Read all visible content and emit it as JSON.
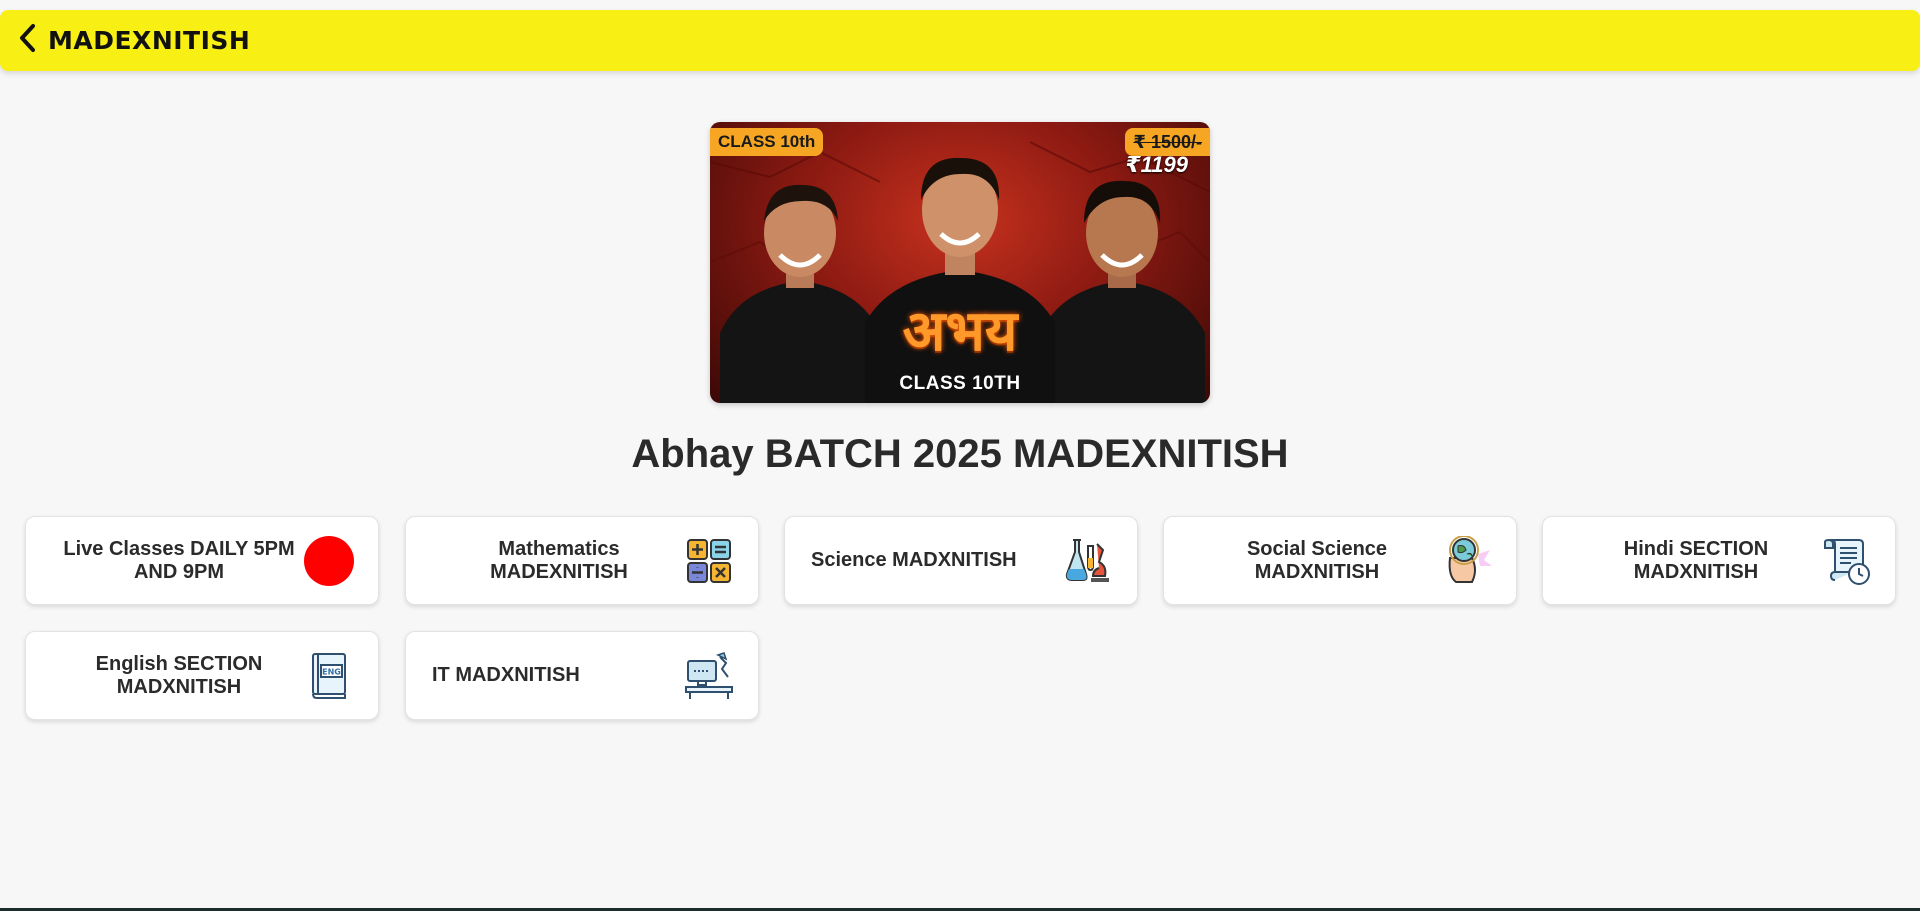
{
  "header": {
    "title": "MADEXNITISH",
    "back_icon": "chevron-left-icon"
  },
  "banner": {
    "class_badge": "CLASS 10th",
    "old_price": "₹ 1500/-",
    "new_price": "₹1199",
    "logo_text": "अभय",
    "class_label": "CLASS 10TH"
  },
  "batch": {
    "title": "Abhay BATCH 2025 MADEXNITISH"
  },
  "sections": [
    {
      "label": "Live Classes DAILY 5PM AND 9PM",
      "icon": "live-dot-icon",
      "color": "#ff0000"
    },
    {
      "label": "Mathematics MADEXNITISH",
      "icon": "calculator-icon"
    },
    {
      "label": "Science MADXNITISH",
      "icon": "lab-flask-microscope-icon"
    },
    {
      "label": "Social Science MADXNITISH",
      "icon": "globe-magnifier-icon"
    },
    {
      "label": "Hindi SECTION MADXNITISH",
      "icon": "scroll-clock-icon"
    },
    {
      "label": "English SECTION MADXNITISH",
      "icon": "english-book-icon"
    },
    {
      "label": "IT MADXNITISH",
      "icon": "computer-desk-icon"
    }
  ],
  "colors": {
    "header_bg": "#f8ef14",
    "page_bg": "#f7f7f7",
    "badge_orange": "#f6a623",
    "live_red": "#ff0000"
  }
}
